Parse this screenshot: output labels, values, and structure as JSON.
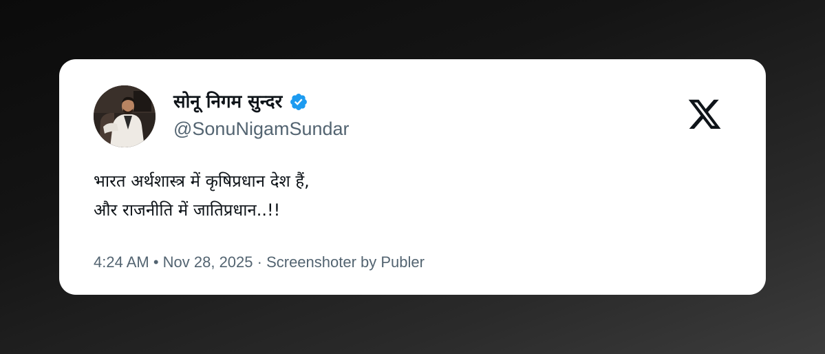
{
  "tweet": {
    "author": {
      "display_name": "सोनू निगम सुन्दर",
      "handle": "@SonuNigamSundar",
      "verified": true,
      "avatar_icon": "profile-photo"
    },
    "platform_icon": "x-logo-icon",
    "text_lines": [
      "भारत अर्थशास्त्र में कृषिप्रधान देश हैं,",
      "और राजनीति में जातिप्रधान..!!"
    ],
    "meta": "4:24 AM • Nov 28, 2025 · Screenshoter by Publer"
  },
  "colors": {
    "verified_blue": "#1d9bf0",
    "text_primary": "#0f1419",
    "text_secondary": "#536471",
    "card_background": "#ffffff"
  }
}
